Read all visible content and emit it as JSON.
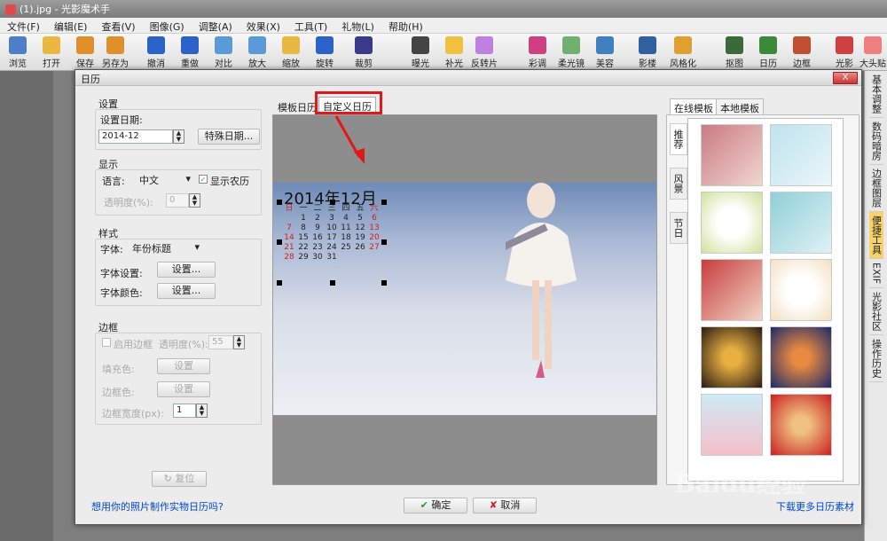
{
  "app": {
    "title": "(1).jpg - 光影魔术手"
  },
  "menu": [
    "文件(F)",
    "编辑(E)",
    "查看(V)",
    "图像(G)",
    "调整(A)",
    "效果(X)",
    "工具(T)",
    "礼物(L)",
    "帮助(H)"
  ],
  "toolbar": [
    {
      "label": "浏览",
      "icon": "eye-icon",
      "color": "#4d7fc8"
    },
    {
      "label": "打开",
      "icon": "folder-icon",
      "color": "#e8b840"
    },
    {
      "label": "保存",
      "icon": "save-icon",
      "color": "#e0902a"
    },
    {
      "label": "另存为",
      "icon": "save-as-icon",
      "color": "#e0902a"
    },
    {
      "label": "撤消",
      "icon": "undo-icon",
      "color": "#2a62c8"
    },
    {
      "label": "重做",
      "icon": "redo-icon",
      "color": "#2a62c8"
    },
    {
      "label": "对比",
      "icon": "compare-icon",
      "color": "#5a9ad8"
    },
    {
      "label": "放大",
      "icon": "zoom-icon",
      "color": "#5a9ad8"
    },
    {
      "label": "缩放",
      "icon": "resize-icon",
      "color": "#e8b840"
    },
    {
      "label": "旋转",
      "icon": "rotate-icon",
      "color": "#2a62c8"
    },
    {
      "label": "裁剪",
      "icon": "crop-icon",
      "color": "#3a3a8a"
    },
    {
      "label": "曝光",
      "icon": "exposure-icon",
      "color": "#444"
    },
    {
      "label": "补光",
      "icon": "fill-light-icon",
      "color": "#f0c040"
    },
    {
      "label": "反转片",
      "icon": "reversal-film-icon",
      "color": "#c080e0"
    },
    {
      "label": "彩调",
      "icon": "color-tone-icon",
      "color": "#d04080"
    },
    {
      "label": "柔光镜",
      "icon": "soft-light-icon",
      "color": "#70b070"
    },
    {
      "label": "美容",
      "icon": "beauty-icon",
      "color": "#4080c0"
    },
    {
      "label": "影楼",
      "icon": "studio-icon",
      "color": "#3060a0"
    },
    {
      "label": "风格化",
      "icon": "stylize-icon",
      "color": "#e0a030"
    },
    {
      "label": "抠图",
      "icon": "cutout-icon",
      "color": "#3a6a3a"
    },
    {
      "label": "日历",
      "icon": "calendar-icon",
      "color": "#3a8a3a"
    },
    {
      "label": "边框",
      "icon": "frame-icon",
      "color": "#c05030"
    },
    {
      "label": "光影",
      "icon": "light-icon",
      "color": "#d04040"
    },
    {
      "label": "大头贴",
      "icon": "sticker-icon",
      "color": "#f08080"
    }
  ],
  "right_strip": [
    "基本调整",
    "数码暗房",
    "边框图层",
    "便捷工具",
    "EXIF",
    "光影社区",
    "操作历史"
  ],
  "dialog": {
    "title": "日历",
    "close": "X",
    "settings": {
      "section": "设置",
      "date_label": "设置日期:",
      "date_value": "2014-12",
      "special_date_button": "特殊日期..."
    },
    "display": {
      "section": "显示",
      "language_label": "语言:",
      "language_value": "中文",
      "show_lunar_label": "显示农历",
      "transparency_label": "透明度(%):",
      "transparency_value": "0"
    },
    "style": {
      "section": "样式",
      "font_label": "字体:",
      "font_value": "年份标题",
      "font_settings_label": "字体设置:",
      "font_settings_button": "设置...",
      "font_color_label": "字体颜色:",
      "font_color_button": "设置..."
    },
    "border": {
      "section": "边框",
      "enable_label": "启用边框",
      "transparency_label": "透明度(%):",
      "transparency_value": "55",
      "fill_color_label": "填充色:",
      "fill_color_button": "设置",
      "border_color_label": "边框色:",
      "border_color_button": "设置",
      "border_width_label": "边框宽度(px):",
      "border_width_value": "1"
    },
    "reset_button": "复位",
    "tabs": [
      "模板日历",
      "自定义日历"
    ],
    "calendar": {
      "title": "2014年12月",
      "rows": [
        [
          "日",
          "一",
          "二",
          "三",
          "四",
          "五",
          "六"
        ],
        [
          "",
          "1",
          "2",
          "3",
          "4",
          "5",
          "6"
        ],
        [
          "7",
          "8",
          "9",
          "10",
          "11",
          "12",
          "13"
        ],
        [
          "14",
          "15",
          "16",
          "17",
          "18",
          "19",
          "20"
        ],
        [
          "21",
          "22",
          "23",
          "24",
          "25",
          "26",
          "27"
        ],
        [
          "28",
          "29",
          "30",
          "31",
          "",
          "",
          ""
        ]
      ]
    },
    "template_tabs": [
      "在线模板",
      "本地模板"
    ],
    "categories": [
      "推荐",
      "风景",
      "节日"
    ],
    "ok_button": "确定",
    "cancel_button": "取消",
    "footer_left": "想用你的照片制作实物日历吗?",
    "footer_right": "下载更多日历素材"
  },
  "watermark": "Baidu经验"
}
